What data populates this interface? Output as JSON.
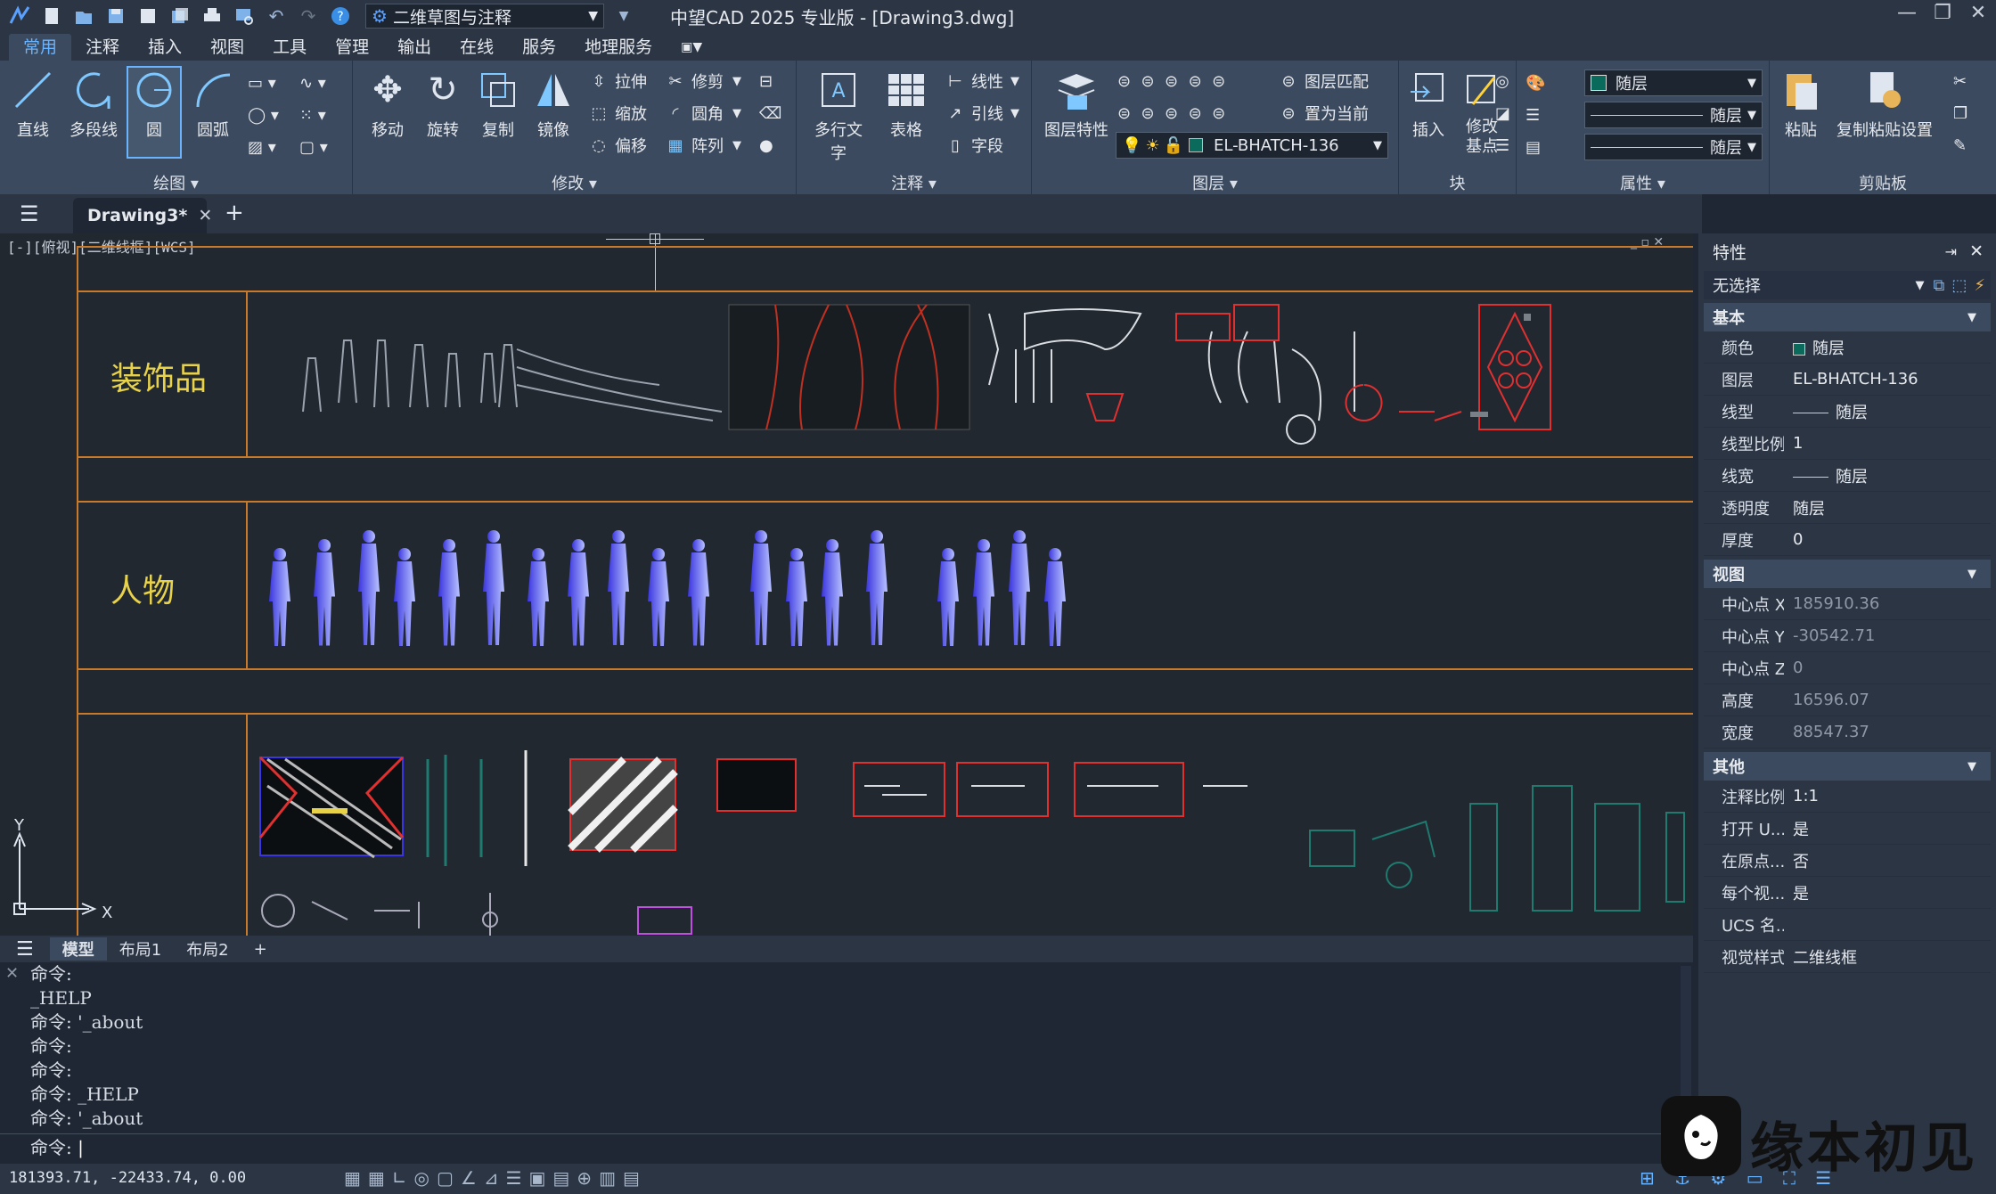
{
  "app": {
    "workspace": "二维草图与注释",
    "window_title": "中望CAD 2025 专业版 - [Drawing3.dwg]"
  },
  "menu": [
    "常用",
    "注释",
    "插入",
    "视图",
    "工具",
    "管理",
    "输出",
    "在线",
    "服务",
    "地理服务"
  ],
  "ribbon": {
    "draw": {
      "label": "绘图",
      "line": "直线",
      "polyline": "多段线",
      "circle": "圆",
      "arc": "圆弧"
    },
    "modify": {
      "label": "修改",
      "move": "移动",
      "rotate": "旋转",
      "copy": "复制",
      "mirror": "镜像",
      "stretch": "拉伸",
      "scale": "缩放",
      "offset": "偏移",
      "trim": "修剪",
      "fillet": "圆角",
      "array": "阵列"
    },
    "annotation": {
      "label": "注释",
      "mtext": "多行文字",
      "table": "表格",
      "linear": "线性",
      "leader": "引线",
      "field": "字段"
    },
    "layers": {
      "label": "图层",
      "props": "图层特性",
      "match": "图层匹配",
      "set_current": "置为当前",
      "layer_name": "EL-BHATCH-136"
    },
    "block": {
      "label": "块",
      "insert": "插入",
      "edit_base": "修改基点"
    },
    "properties": {
      "label": "属性",
      "color": "随层",
      "linetype": "随层",
      "lineweight": "随层"
    },
    "clipboard": {
      "label": "剪贴板",
      "paste": "粘贴",
      "paste_special": "复制粘贴设置"
    }
  },
  "doc_tab": "Drawing3*",
  "viewport_label": "[-][俯视][二维线框][WCS]",
  "canvas": {
    "cat1": "装饰品",
    "cat2": "人物",
    "axis_y": "Y",
    "axis_x": "X"
  },
  "layout_tabs": [
    "模型",
    "布局1",
    "布局2"
  ],
  "command_history": [
    "命令:",
    "_HELP",
    "命令: '_about",
    "命令:",
    "命令:",
    "命令: _HELP",
    "命令: '_about"
  ],
  "command_prompt": "命令:",
  "coords": "181393.71, -22433.74, 0.00",
  "properties": {
    "title": "特性",
    "selection": "无选择",
    "basic": {
      "label": "基本",
      "rows": [
        [
          "颜色",
          "随层"
        ],
        [
          "图层",
          "EL-BHATCH-136"
        ],
        [
          "线型",
          "随层"
        ],
        [
          "线型比例",
          "1"
        ],
        [
          "线宽",
          "随层"
        ],
        [
          "透明度",
          "随层"
        ],
        [
          "厚度",
          "0"
        ]
      ]
    },
    "view": {
      "label": "视图",
      "rows": [
        [
          "中心点 X",
          "185910.36"
        ],
        [
          "中心点 Y",
          "-30542.71"
        ],
        [
          "中心点 Z",
          "0"
        ],
        [
          "高度",
          "16596.07"
        ],
        [
          "宽度",
          "88547.37"
        ]
      ]
    },
    "other": {
      "label": "其他",
      "rows": [
        [
          "注释比例",
          "1:1"
        ],
        [
          "打开 U...",
          "是"
        ],
        [
          "在原点...",
          "否"
        ],
        [
          "每个视...",
          "是"
        ],
        [
          "UCS 名...",
          ""
        ],
        [
          "视觉样式",
          "二维线框"
        ]
      ]
    }
  },
  "watermark": "缘本初见"
}
